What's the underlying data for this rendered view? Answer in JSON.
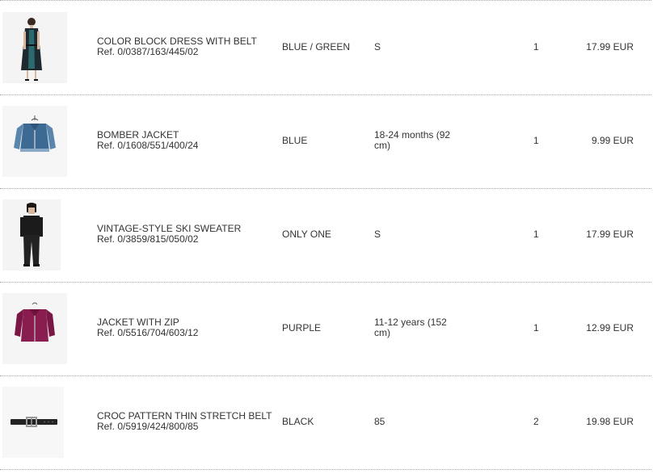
{
  "items": [
    {
      "name": "COLOR BLOCK DRESS WITH BELT",
      "ref": "Ref. 0/0387/163/445/02",
      "color": "BLUE / GREEN",
      "size": "S",
      "quantity": "1",
      "price": "17.99 EUR",
      "image": "dress-photo"
    },
    {
      "name": "BOMBER JACKET",
      "ref": "Ref. 0/1608/551/400/24",
      "color": "BLUE",
      "size": "18-24 months (92 cm)",
      "quantity": "1",
      "price": "9.99 EUR",
      "image": "denim-jacket-photo"
    },
    {
      "name": "VINTAGE-STYLE SKI SWEATER",
      "ref": "Ref. 0/3859/815/050/02",
      "color": "ONLY ONE",
      "size": "S",
      "quantity": "1",
      "price": "17.99 EUR",
      "image": "sweater-photo"
    },
    {
      "name": "JACKET WITH ZIP",
      "ref": "Ref. 0/5516/704/603/12",
      "color": "PURPLE",
      "size": "11-12 years (152 cm)",
      "quantity": "1",
      "price": "12.99 EUR",
      "image": "purple-jacket-photo"
    },
    {
      "name": "CROC PATTERN THIN STRETCH BELT",
      "ref": "Ref. 0/5919/424/800/85",
      "color": "BLACK",
      "size": "85",
      "quantity": "2",
      "price": "19.98 EUR",
      "image": "belt-photo"
    }
  ]
}
